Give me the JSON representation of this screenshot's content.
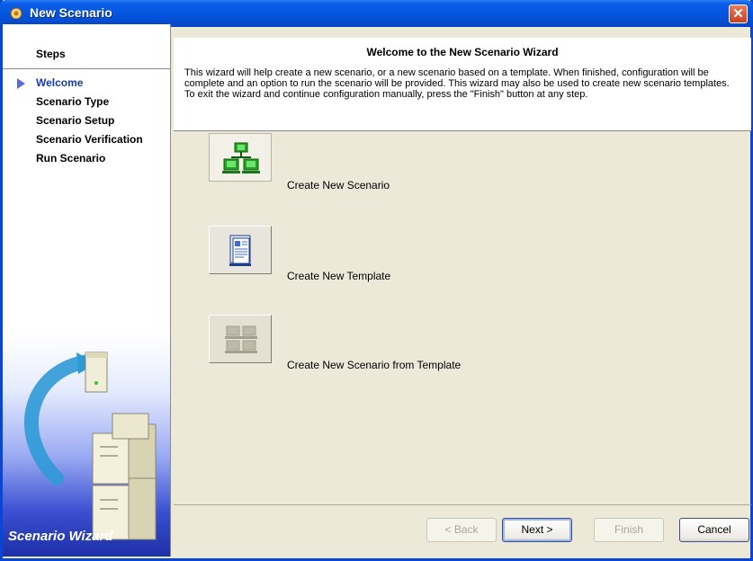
{
  "window": {
    "title": "New Scenario",
    "close_label": "✕"
  },
  "steps": {
    "header": "Steps",
    "items": [
      {
        "label": "Welcome",
        "active": true
      },
      {
        "label": "Scenario Type",
        "active": false
      },
      {
        "label": "Scenario Setup",
        "active": false
      },
      {
        "label": "Scenario Verification",
        "active": false
      },
      {
        "label": "Run Scenario",
        "active": false
      }
    ],
    "art_label": "Scenario Wizard"
  },
  "header": {
    "title": "Welcome to the New Scenario Wizard",
    "description_1": "This wizard will help create a new scenario, or a new scenario based on a template.  When finished, configuration will be complete and an option to run the scenario will be provided.  This wizard may also be used to create new scenario templates.",
    "description_2": "To exit the wizard and continue configuration manually, press the \"Finish\" button at any step."
  },
  "options": [
    {
      "label": "Create New Scenario",
      "icon": "network-computers-icon",
      "state": "selected"
    },
    {
      "label": "Create New Template",
      "icon": "document-template-icon",
      "state": "normal"
    },
    {
      "label": "Create New Scenario from Template",
      "icon": "network-computers-icon",
      "state": "disabled"
    }
  ],
  "buttons": {
    "back": "< Back",
    "next": "Next >",
    "finish": "Finish",
    "cancel": "Cancel"
  },
  "colors": {
    "title_bar": "#0453dc",
    "active_step": "#1a3aa8",
    "close_button": "#c9421f",
    "icon_green": "#22a322"
  }
}
